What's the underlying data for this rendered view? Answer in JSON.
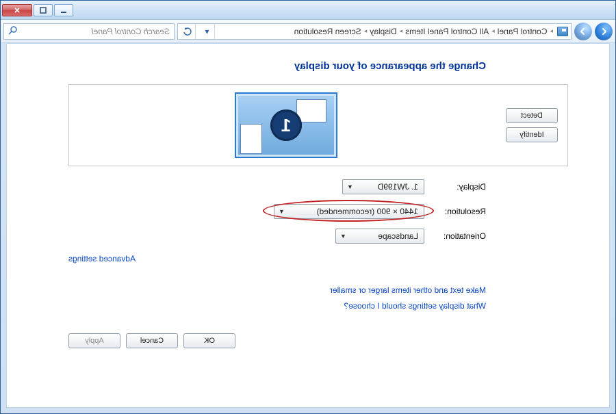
{
  "titlebar": {},
  "navbar": {
    "breadcrumbs": [
      "Control Panel",
      "All Control Panel Items",
      "Display",
      "Screen Resolution"
    ],
    "search_placeholder": "Search Control Panel"
  },
  "page": {
    "title": "Change the appearance of your display",
    "detect_label": "Detect",
    "identify_label": "Identify",
    "monitor_number": "1",
    "rows": {
      "display_label": "Display:",
      "display_value": "1. JW199D",
      "resolution_label": "Resolution:",
      "resolution_value": "1440 × 900 (recommended)",
      "orientation_label": "Orientation:",
      "orientation_value": "Landscape"
    },
    "advanced_link": "Advanced settings",
    "help1": "Make text and other items larger or smaller",
    "help2": "What display settings should I choose?",
    "ok_label": "OK",
    "cancel_label": "Cancel",
    "apply_label": "Apply"
  }
}
